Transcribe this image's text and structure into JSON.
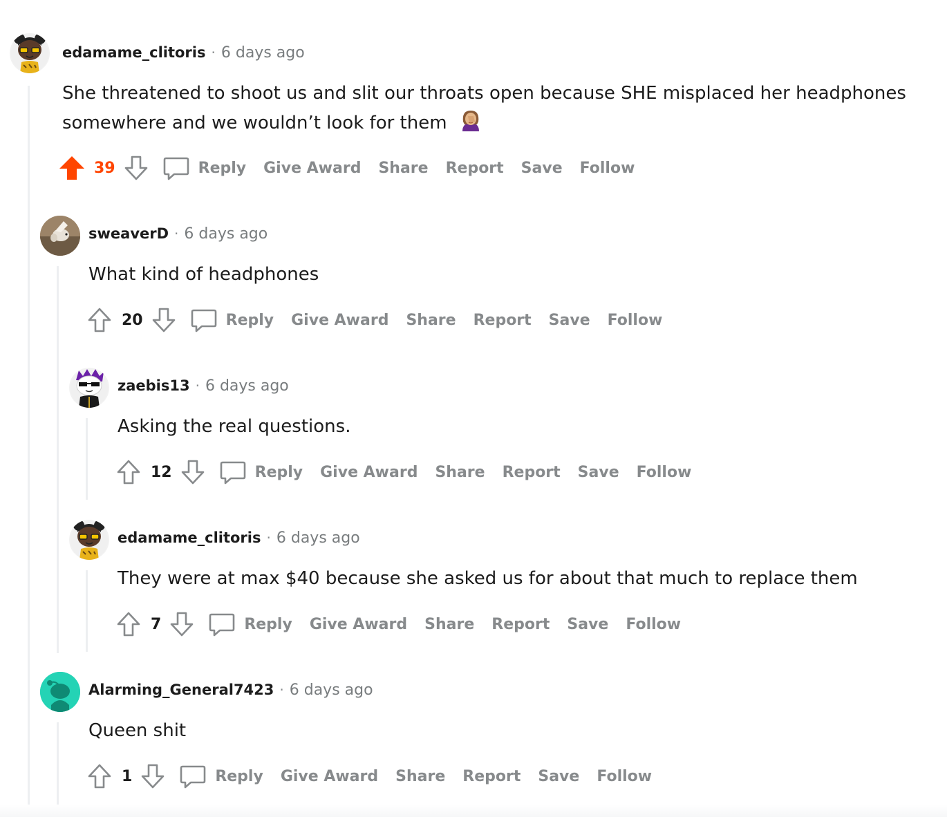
{
  "comments": [
    {
      "username": "edamame_clitoris",
      "separator": "·",
      "time": "6 days ago",
      "body": "She threatened to shoot us and slit our throats open because SHE misplaced her headphones somewhere and we wouldn’t look for them",
      "emoji": "facepalm-woman-emoji",
      "score": "39",
      "upvoted": true,
      "actions": {
        "reply": "Reply",
        "award": "Give Award",
        "share": "Share",
        "report": "Report",
        "save": "Save",
        "follow": "Follow"
      }
    },
    {
      "username": "sweaverD",
      "separator": "·",
      "time": "6 days ago",
      "body": "What kind of headphones",
      "score": "20",
      "upvoted": false,
      "actions": {
        "reply": "Reply",
        "award": "Give Award",
        "share": "Share",
        "report": "Report",
        "save": "Save",
        "follow": "Follow"
      }
    },
    {
      "username": "zaebis13",
      "separator": "·",
      "time": "6 days ago",
      "body": "Asking the real questions.",
      "score": "12",
      "upvoted": false,
      "actions": {
        "reply": "Reply",
        "award": "Give Award",
        "share": "Share",
        "report": "Report",
        "save": "Save",
        "follow": "Follow"
      }
    },
    {
      "username": "edamame_clitoris",
      "separator": "·",
      "time": "6 days ago",
      "body": "They were at max $40 because she asked us for about that much to replace them",
      "score": "7",
      "upvoted": false,
      "actions": {
        "reply": "Reply",
        "award": "Give Award",
        "share": "Share",
        "report": "Report",
        "save": "Save",
        "follow": "Follow"
      }
    },
    {
      "username": "Alarming_General7423",
      "separator": "·",
      "time": "6 days ago",
      "body": "Queen shit",
      "score": "1",
      "upvoted": false,
      "actions": {
        "reply": "Reply",
        "award": "Give Award",
        "share": "Share",
        "report": "Report",
        "save": "Save",
        "follow": "Follow"
      }
    }
  ],
  "colors": {
    "upvote": "#ff4500",
    "action": "#878a8c",
    "thread": "#edeff1",
    "text": "#1c1c1c"
  },
  "icons": {
    "upvote": "arrow-up-icon",
    "downvote": "arrow-down-icon",
    "reply": "speech-bubble-icon"
  }
}
